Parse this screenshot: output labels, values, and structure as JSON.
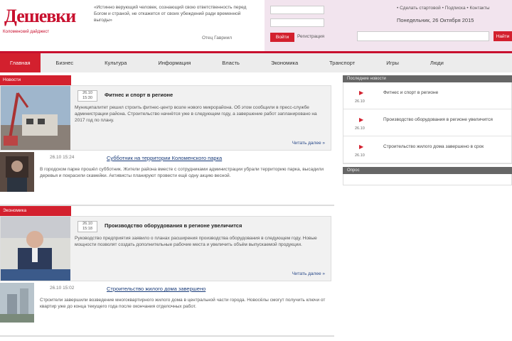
{
  "header": {
    "logo_main": "Дешевки",
    "logo_sub": "Коломенский дайджест",
    "quote": "«Истинно верующий человек, сознающий свою ответственность перед Богом и страной, не откажется от своих убеждений ради временной выгоды»",
    "quote_author": "Отец Гавриил",
    "login_button": "Войти",
    "register_link": "Регистрация",
    "top_links": "• Сделать стартовой  • Подписка  • Контакты",
    "date": "Понедельник, 26 Октября 2015",
    "search_button": "Найти"
  },
  "nav": {
    "items": [
      {
        "label": "Главная"
      },
      {
        "label": "Бизнес"
      },
      {
        "label": "Культура"
      },
      {
        "label": "Информация"
      },
      {
        "label": "Власть"
      },
      {
        "label": "Экономика"
      },
      {
        "label": "Транспорт"
      },
      {
        "label": "Игры"
      },
      {
        "label": "Люди"
      }
    ]
  },
  "sections": [
    {
      "tag": "Новости",
      "lead": {
        "date": "26.10 15:30",
        "title": "Фитнес и спорт в регионе",
        "text": "Муниципалитет решил строить фитнес-центр возле нового микрорайона. Об этом сообщили в пресс-службе администрации района. Строительство начнётся уже в следующем году, а завершение работ запланировано на 2017 год по плану.",
        "more": "Читать далее »"
      },
      "item": {
        "date": "26.10 15:24",
        "title": "Субботник на территории Коломенского парка",
        "text": "В городском парке прошёл субботник. Жители района вместе с сотрудниками администрации убрали территорию парка, высадили деревья и покрасили скамейки. Активисты планируют провести ещё одну акцию весной."
      }
    },
    {
      "tag": "Экономика",
      "lead": {
        "date": "26.10 15:18",
        "title": "Производство оборудования в регионе увеличится",
        "text": "Руководство предприятия заявило о планах расширения производства оборудования в следующем году. Новые мощности позволят создать дополнительные рабочие места и увеличить объём выпускаемой продукции.",
        "more": "Читать далее »"
      },
      "item": {
        "date": "26.10 15:02",
        "title": "Строительство жилого дома завершено",
        "text": "Строители завершили возведение многоквартирного жилого дома в центральной части города. Новосёлы смогут получить ключи от квартир уже до конца текущего года после окончания отделочных работ."
      }
    }
  ],
  "sidebar": {
    "head": "Последние новости",
    "items": [
      {
        "date": "26.10",
        "text": "Фитнес и спорт в регионе"
      },
      {
        "date": "26.10",
        "text": "Производство оборудования в регионе увеличится"
      },
      {
        "date": "26.10",
        "text": "Строительство жилого дома завершено в срок"
      }
    ],
    "head2": "Опрос"
  },
  "colors": {
    "accent": "#d3202e",
    "nav_bg": "#ececec",
    "login_bg": "#f2e4ee"
  }
}
